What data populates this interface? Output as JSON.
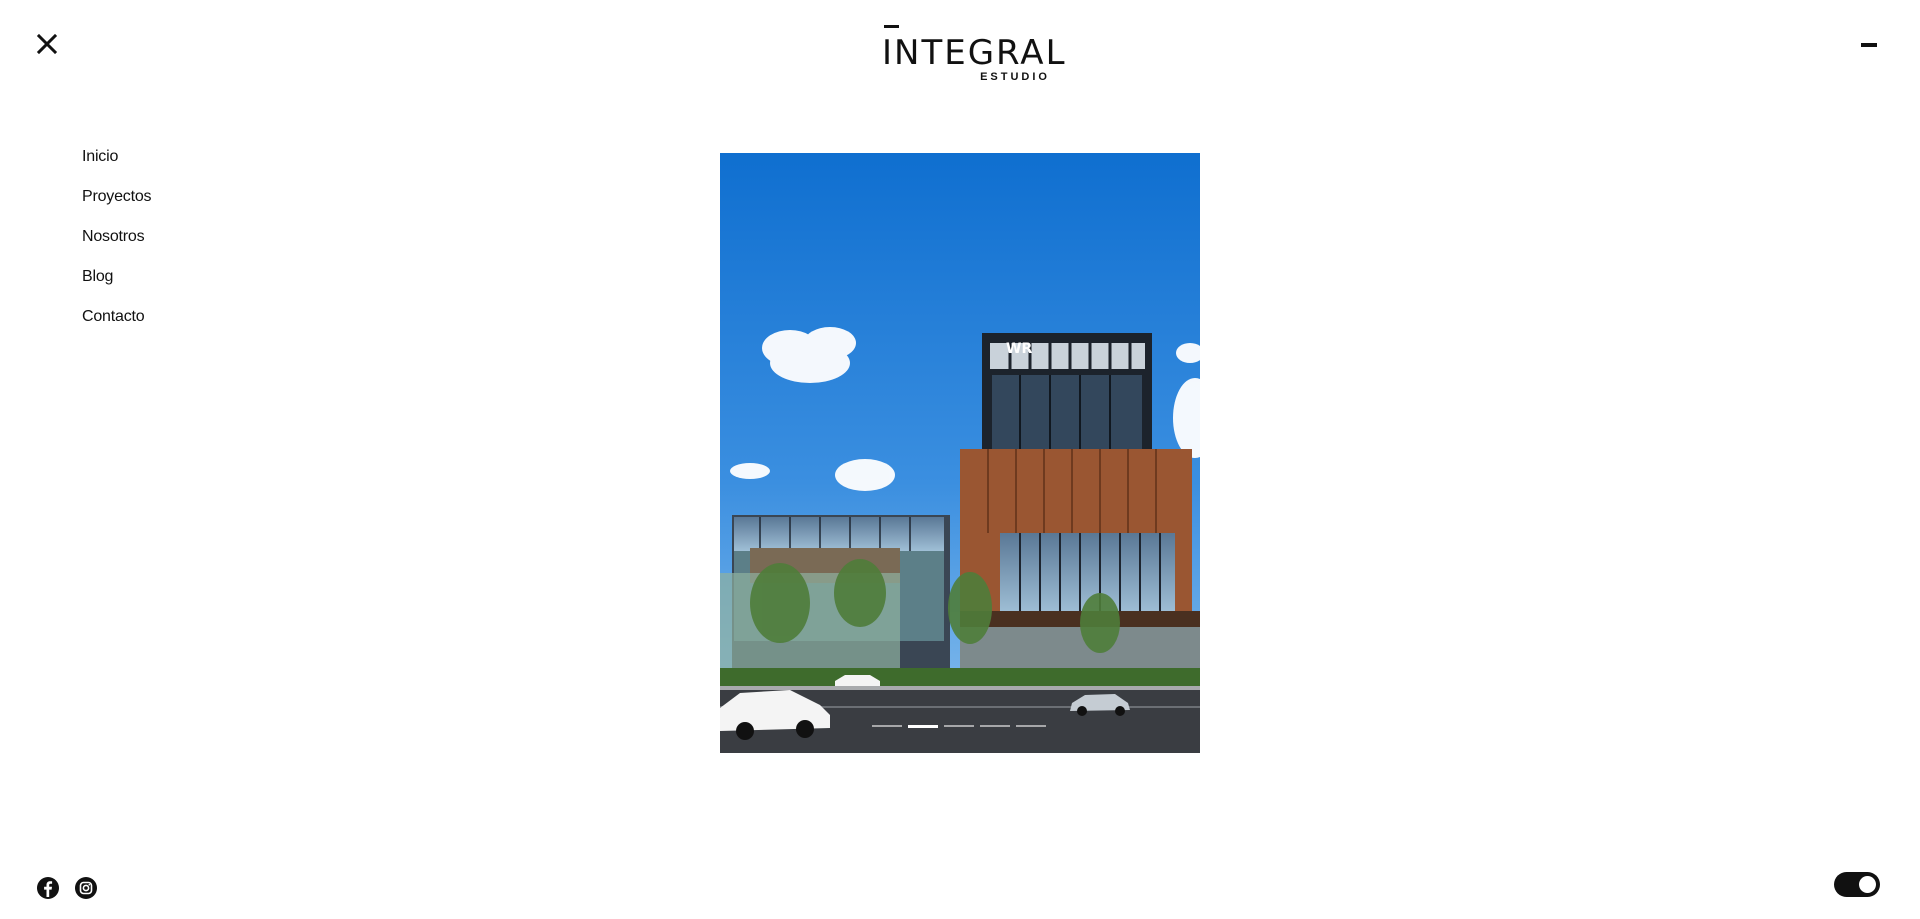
{
  "header": {
    "logo_main": "INTEGRAL",
    "logo_sub": "ESTUDIO",
    "close_icon": "close-icon",
    "minimize_icon": "minus-icon"
  },
  "nav": {
    "items": [
      {
        "label": "Inicio"
      },
      {
        "label": "Proyectos"
      },
      {
        "label": "Nosotros"
      },
      {
        "label": "Blog"
      },
      {
        "label": "Contacto"
      }
    ]
  },
  "slider": {
    "image": "building-rendering-image",
    "sign_text": "WR",
    "slide_count": 5,
    "active_slide": 2
  },
  "footer": {
    "social": [
      {
        "icon": "facebook-icon"
      },
      {
        "icon": "instagram-icon"
      }
    ],
    "theme_toggle": {
      "icon": "toggle-switch",
      "state": "on"
    }
  },
  "colors": {
    "text": "#111111",
    "background": "#ffffff",
    "sky": "#2b7fd4",
    "brick": "#9a5632"
  }
}
